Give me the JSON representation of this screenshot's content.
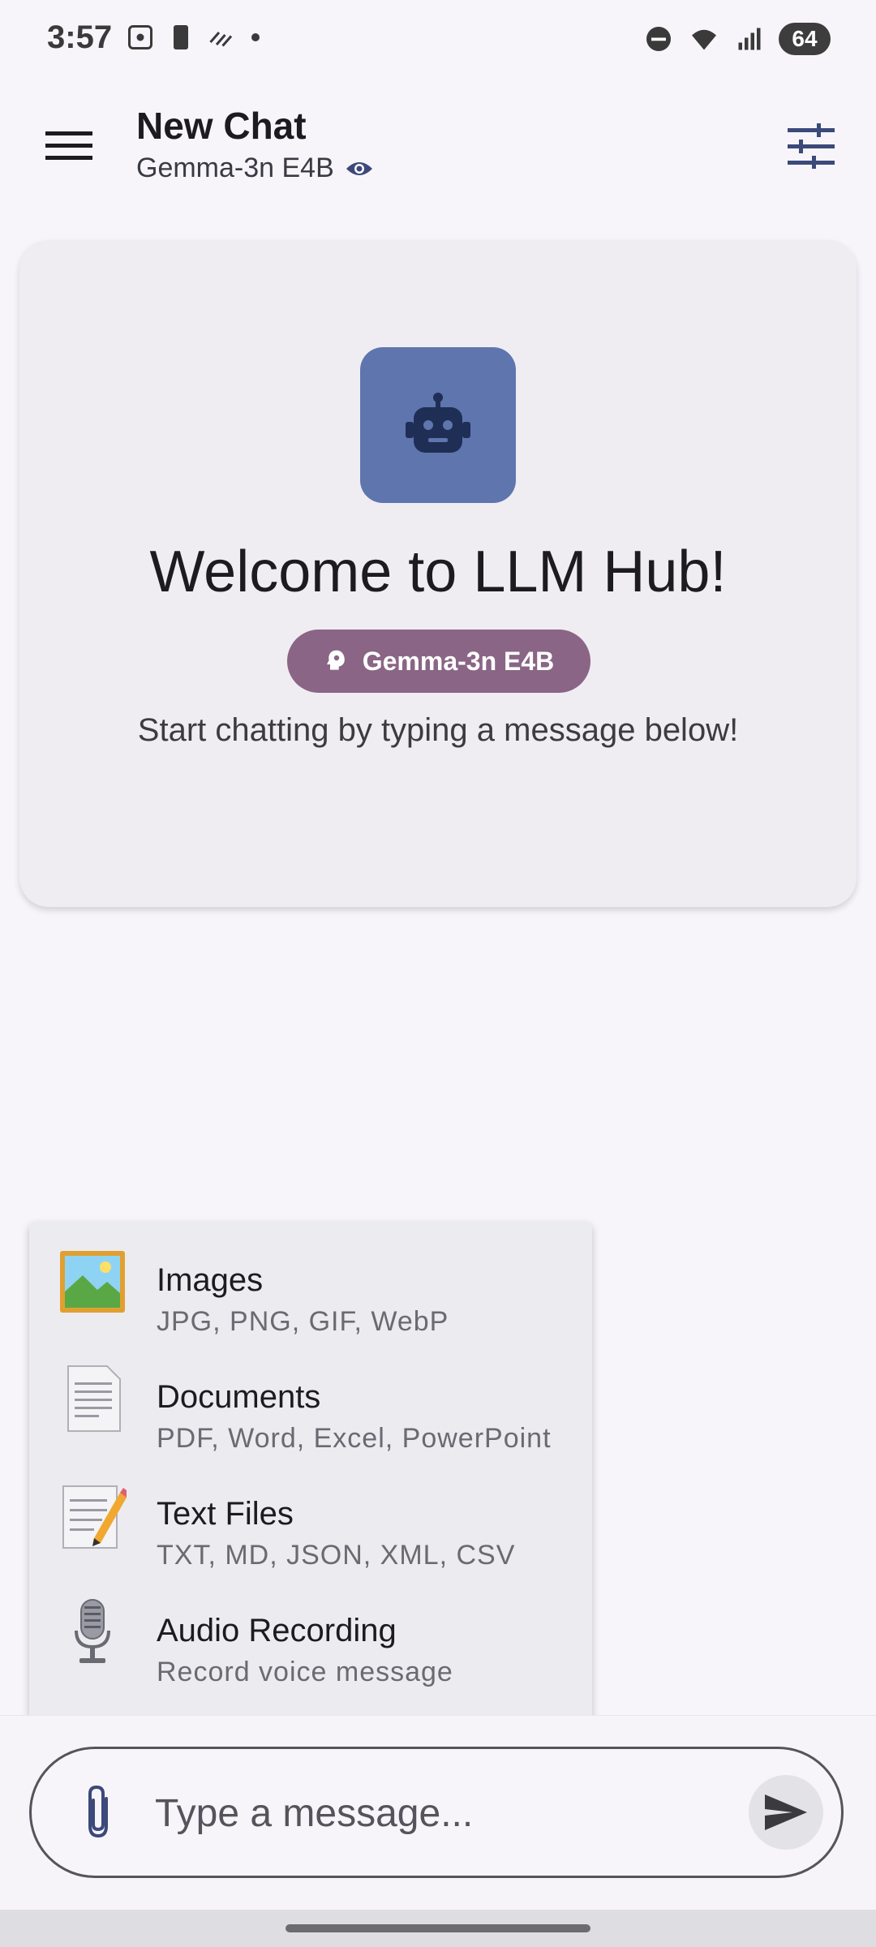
{
  "status_bar": {
    "time": "3:57",
    "battery": "64"
  },
  "header": {
    "title": "New Chat",
    "model": "Gemma-3n E4B"
  },
  "welcome": {
    "title": "Welcome to LLM Hub!",
    "model_chip": "Gemma-3n E4B",
    "subtitle": "Start chatting by typing a message below!"
  },
  "attach_menu": {
    "items": [
      {
        "label": "Images",
        "desc": "JPG, PNG, GIF, WebP",
        "icon": "image-icon"
      },
      {
        "label": "Documents",
        "desc": "PDF, Word, Excel, PowerPoint",
        "icon": "document-icon"
      },
      {
        "label": "Text Files",
        "desc": "TXT, MD, JSON, XML, CSV",
        "icon": "memo-icon"
      },
      {
        "label": "Audio Recording",
        "desc": "Record voice message",
        "icon": "microphone-icon"
      }
    ]
  },
  "composer": {
    "placeholder": "Type a message..."
  },
  "colors": {
    "accent": "#3b4a7a",
    "bot_tile": "#5f75ae",
    "chip": "#8a6585"
  }
}
